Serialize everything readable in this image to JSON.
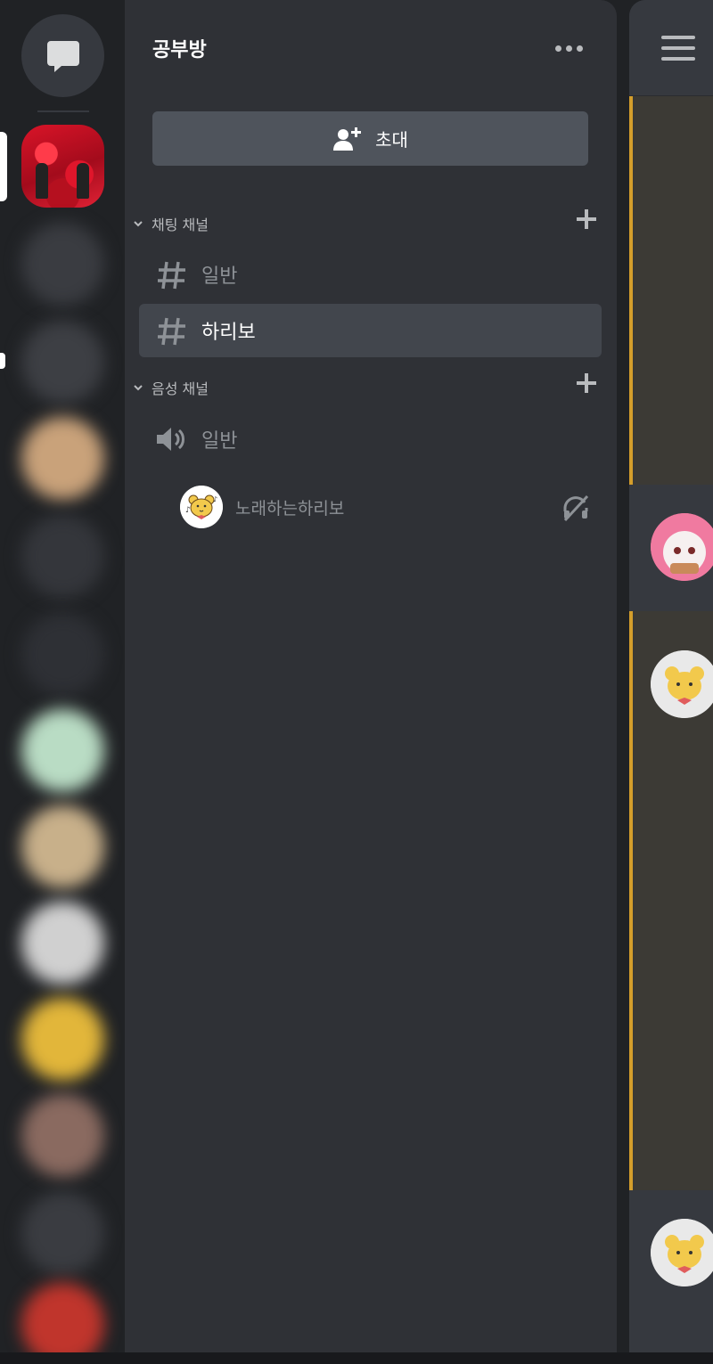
{
  "server": {
    "name": "공부방",
    "invite_label": "초대"
  },
  "categories": [
    {
      "name": "채팅 채널",
      "channels": [
        {
          "name": "일반",
          "type": "text",
          "active": false
        },
        {
          "name": "하리보",
          "type": "text",
          "active": true
        }
      ]
    },
    {
      "name": "음성 채널",
      "channels": [
        {
          "name": "일반",
          "type": "voice",
          "active": false
        }
      ],
      "voice_users": [
        {
          "name": "노래하는하리보",
          "avatar": "bear-avatar",
          "status_icon": "deafened-icon"
        }
      ]
    }
  ],
  "icons": {
    "direct_messages": "chat-bubble-icon",
    "more": "more-options-icon",
    "invite": "add-user-icon",
    "add_channel": "plus-icon",
    "text_channel": "hash-icon",
    "voice_channel": "speaker-icon",
    "menu": "hamburger-icon"
  },
  "colors": {
    "mention_highlight": "#d49e2b",
    "active_channel_bg": "#42464d"
  }
}
